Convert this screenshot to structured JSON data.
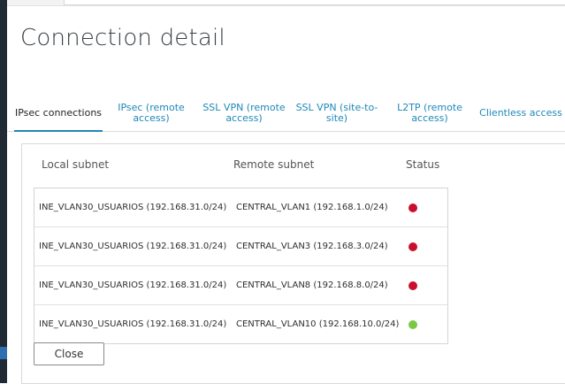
{
  "dialog": {
    "title": "Connection detail"
  },
  "tabs": [
    {
      "label": "IPsec connections",
      "active": true
    },
    {
      "label": "IPsec (remote access)",
      "active": false
    },
    {
      "label": "SSL VPN (remote access)",
      "active": false
    },
    {
      "label": "SSL VPN (site-to-site)",
      "active": false
    },
    {
      "label": "L2TP (remote access)",
      "active": false
    },
    {
      "label": "Clientless access",
      "active": false
    }
  ],
  "table": {
    "headers": {
      "local": "Local subnet",
      "remote": "Remote subnet",
      "status": "Status"
    },
    "rows": [
      {
        "local": "INE_VLAN30_USUARIOS (192.168.31.0/24)",
        "remote": "CENTRAL_VLAN1 (192.168.1.0/24)",
        "status": "down"
      },
      {
        "local": "INE_VLAN30_USUARIOS (192.168.31.0/24)",
        "remote": "CENTRAL_VLAN3 (192.168.3.0/24)",
        "status": "down"
      },
      {
        "local": "INE_VLAN30_USUARIOS (192.168.31.0/24)",
        "remote": "CENTRAL_VLAN8 (192.168.8.0/24)",
        "status": "down"
      },
      {
        "local": "INE_VLAN30_USUARIOS (192.168.31.0/24)",
        "remote": "CENTRAL_VLAN10 (192.168.10.0/24)",
        "status": "up"
      }
    ]
  },
  "status_colors": {
    "down": "#c8102e",
    "up": "#7ac943"
  },
  "footer": {
    "close_label": "Close"
  },
  "accent_color": "#1f88b8"
}
